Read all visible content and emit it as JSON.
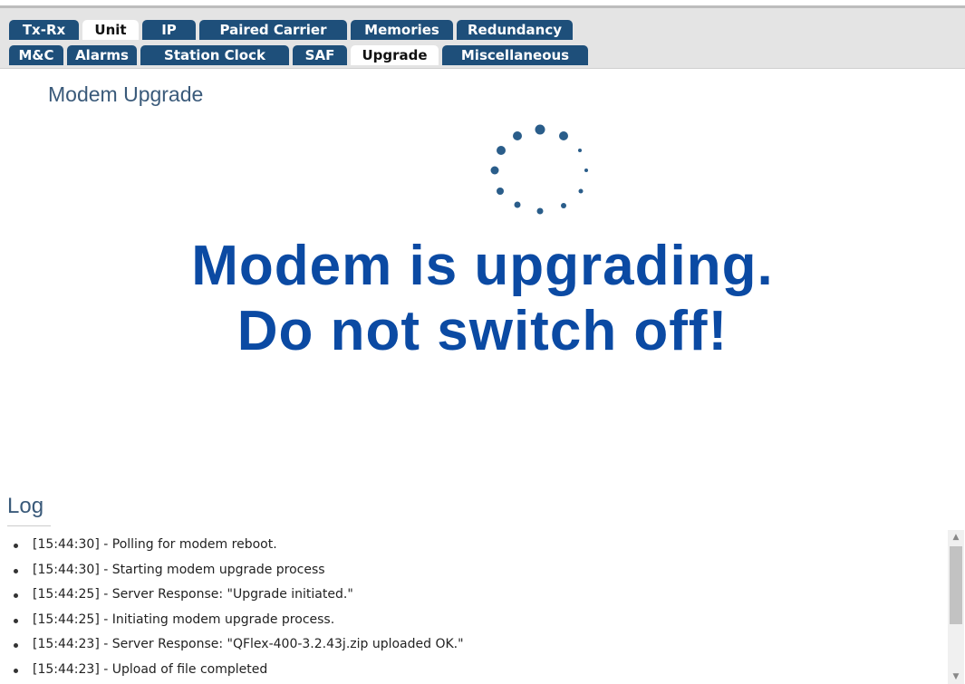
{
  "tabs": {
    "row1": [
      {
        "label": "Tx-Rx",
        "active": false
      },
      {
        "label": "Unit",
        "active": true
      },
      {
        "label": "IP",
        "active": false
      },
      {
        "label": "Paired Carrier",
        "active": false
      },
      {
        "label": "Memories",
        "active": false
      },
      {
        "label": "Redundancy",
        "active": false
      }
    ],
    "row2": [
      {
        "label": "M&C",
        "active": false
      },
      {
        "label": "Alarms",
        "active": false
      },
      {
        "label": "Station Clock",
        "active": false
      },
      {
        "label": "SAF",
        "active": false
      },
      {
        "label": "Upgrade",
        "active": true
      },
      {
        "label": "Miscellaneous",
        "active": false
      }
    ]
  },
  "page": {
    "section_title": "Modem Upgrade",
    "message_line1": "Modem is upgrading.",
    "message_line2": "Do not switch off!",
    "spinner_icon": "loading-spinner-icon"
  },
  "log": {
    "title": "Log",
    "entries": [
      "[15:44:30] - Polling for modem reboot.",
      "[15:44:30] - Starting modem upgrade process",
      "[15:44:25] - Server Response: \"Upgrade initiated.\"",
      "[15:44:25] - Initiating modem upgrade process.",
      "[15:44:23] - Server Response: \"QFlex-400-3.2.43j.zip uploaded OK.\"",
      "[15:44:23] - Upload of file completed"
    ]
  },
  "colors": {
    "tab_bg": "#1e4f7a",
    "message": "#0b4aa3",
    "heading": "#3a5a7a"
  }
}
